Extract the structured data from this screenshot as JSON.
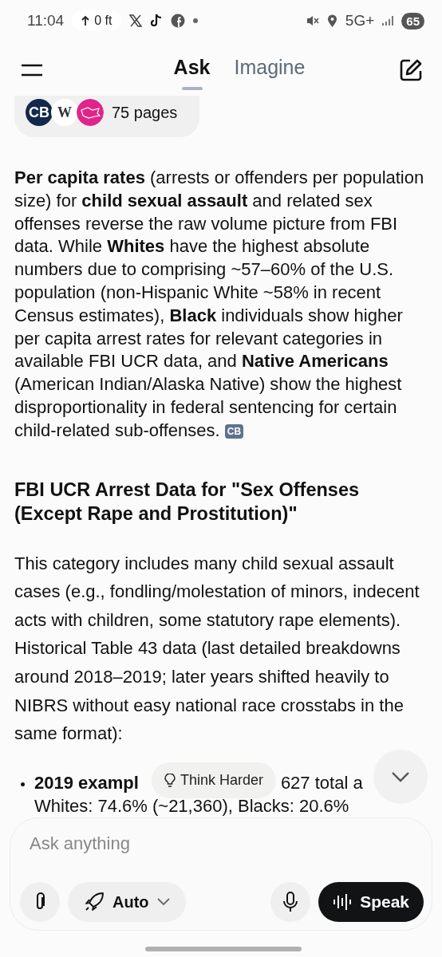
{
  "status_bar": {
    "time": "11:04",
    "altitude": "0 ft",
    "network": "5G+",
    "battery": "65"
  },
  "header": {
    "tabs": [
      {
        "label": "Ask",
        "selected": true
      },
      {
        "label": "Imagine",
        "selected": false
      }
    ]
  },
  "sources": {
    "icons": [
      {
        "kind": "letters",
        "label": "CB",
        "color": "#13294b"
      },
      {
        "kind": "letters",
        "label": "W",
        "color": "#ffffff"
      },
      {
        "kind": "map",
        "color": "#e0258a"
      }
    ],
    "count": "75 pages"
  },
  "answer": [
    {
      "kind": "paragraph",
      "text": "**Per capita rates** (arrests or offenders per population size) for **child sexual assault** and related sex offenses reverse the raw volume picture from FBI data. While **Whites** have the highest absolute numbers due to comprising ~57–60% of the U.S. population (non-Hispanic White ~58% in recent Census estimates), **Black** individuals show higher per capita arrest rates for relevant categories in available FBI UCR data, and **Native Americans** (American Indian/Alaska Native) show the highest disproportionality in federal sentencing for certain child-related sub-offenses.",
      "citation": "CB"
    },
    {
      "kind": "heading",
      "text": "FBI UCR Arrest Data for \"Sex Offenses (Except Rape and Prostitution)\""
    },
    {
      "kind": "paragraph",
      "text": "This category includes many child sexual assault cases (e.g., fondling/molestation of minors, indecent acts with children, some statutory rape elements). Historical Table 43 data (last detailed breakdowns around 2018–2019; later years shifted heavily to NIBRS without easy national race crosstabs in the same format):"
    },
    {
      "kind": "bullet",
      "parts": [
        {
          "text": "2019 exampl",
          "bold": true
        },
        {
          "text": "627 total a",
          "bold": false
        }
      ],
      "continuation": "Whites: 74.6% (~21,360), Blacks: 20.6%"
    }
  ],
  "think_harder": {
    "label": "Think Harder"
  },
  "composer": {
    "placeholder": "Ask anything",
    "mode": "Auto",
    "speak": "Speak"
  }
}
